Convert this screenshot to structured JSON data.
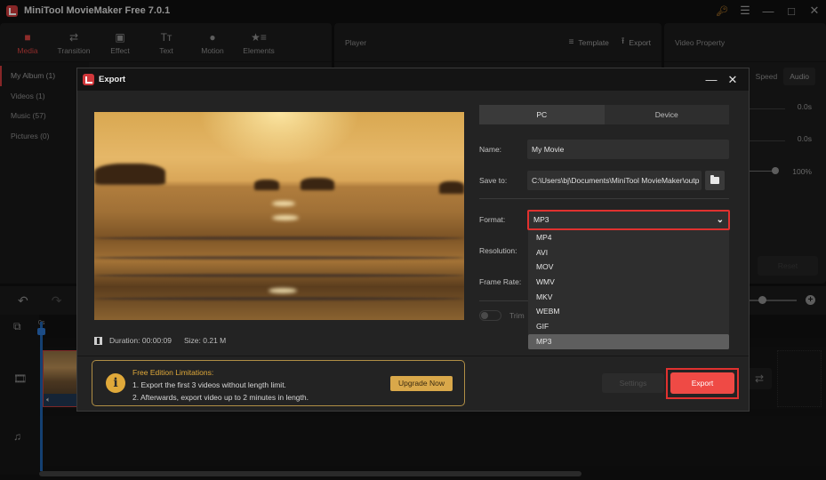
{
  "app": {
    "title": "MiniTool MovieMaker Free 7.0.1",
    "window_controls": [
      "key-icon",
      "menu-icon",
      "minimize-icon",
      "maximize-icon",
      "close-icon"
    ]
  },
  "toolbar": {
    "tabs": [
      {
        "label": "Media",
        "icon": "folder-icon",
        "active": true
      },
      {
        "label": "Transition",
        "icon": "swap-arrows-icon",
        "active": false
      },
      {
        "label": "Effect",
        "icon": "effect-icon",
        "active": false
      },
      {
        "label": "Text",
        "icon": "text-icon",
        "active": false
      },
      {
        "label": "Motion",
        "icon": "motion-icon",
        "active": false
      },
      {
        "label": "Elements",
        "icon": "elements-icon",
        "active": false
      }
    ]
  },
  "media_nav": {
    "items": [
      {
        "label": "My Album (1)",
        "active": true
      },
      {
        "label": "Videos (1)",
        "active": false
      },
      {
        "label": "Music (57)",
        "active": false
      },
      {
        "label": "Pictures (0)",
        "active": false
      }
    ]
  },
  "player": {
    "title": "Player",
    "template_label": "Template",
    "export_label": "Export"
  },
  "video_property": {
    "title": "Video Property",
    "tabs": [
      {
        "label": "Speed",
        "active": false
      },
      {
        "label": "Audio",
        "active": true
      }
    ],
    "fade_in": "0.0s",
    "fade_out": "0.0s",
    "volume": "100%",
    "reset_label": "Reset"
  },
  "timeline": {
    "ruler_start": "0s",
    "zoom_level": 0.35
  },
  "export_dialog": {
    "title": "Export",
    "duration_label": "Duration:",
    "duration": "00:00:09",
    "size_label": "Size:",
    "size": "0.21 M",
    "target_tabs": [
      {
        "label": "PC",
        "active": true
      },
      {
        "label": "Device",
        "active": false
      }
    ],
    "name_label": "Name:",
    "name_value": "My Movie",
    "save_to_label": "Save to:",
    "save_to_value": "C:\\Users\\bj\\Documents\\MiniTool MovieMaker\\outp",
    "format_label": "Format:",
    "format_value": "MP3",
    "format_options": [
      "MP4",
      "AVI",
      "MOV",
      "WMV",
      "MKV",
      "WEBM",
      "GIF",
      "MP3"
    ],
    "resolution_label": "Resolution:",
    "frame_rate_label": "Frame Rate:",
    "trim_label": "Trim",
    "trim_enabled": false,
    "limitations": {
      "title": "Free Edition Limitations:",
      "line1": "1. Export the first 3 videos without length limit.",
      "line2": "2. Afterwards, export video up to 2 minutes in length.",
      "upgrade_label": "Upgrade Now"
    },
    "settings_label": "Settings",
    "export_label": "Export"
  },
  "colors": {
    "accent_red": "#ef4a45",
    "highlight_frame": "#e0312f",
    "upgrade_gold": "#d9a84a",
    "playhead_blue": "#1e5fa8"
  }
}
